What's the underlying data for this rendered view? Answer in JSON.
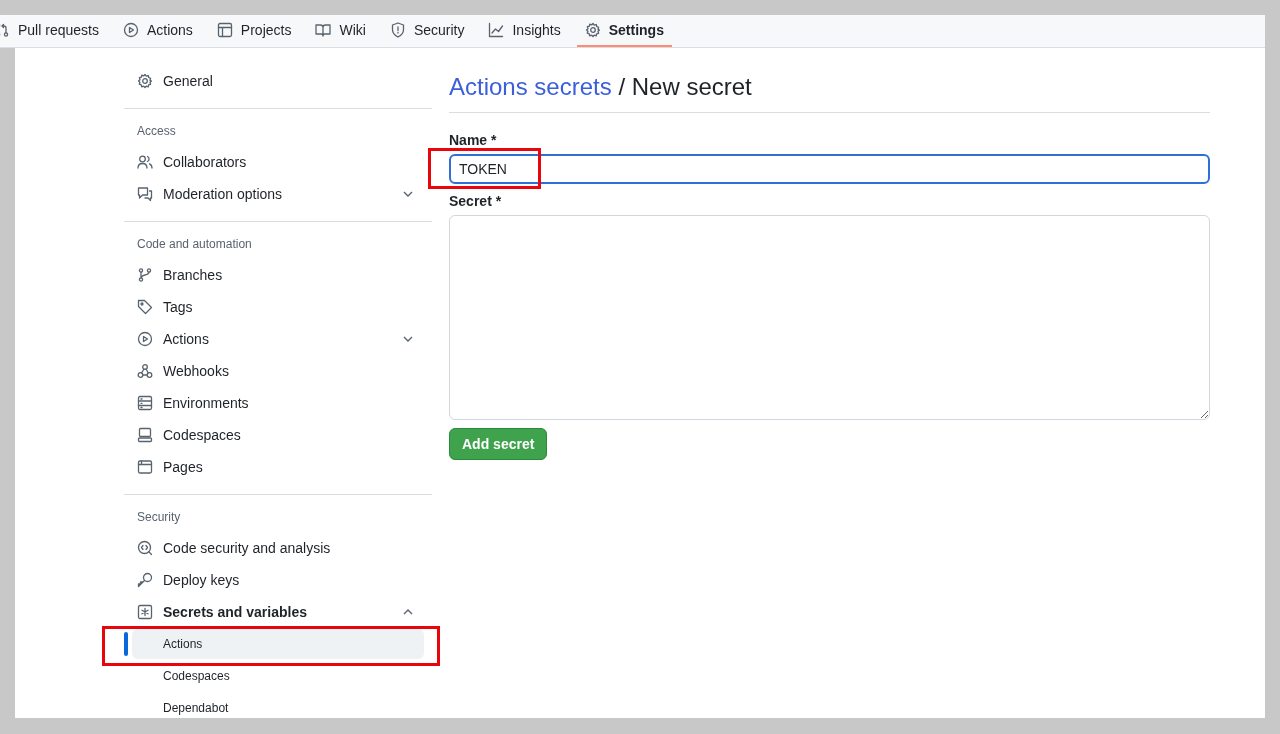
{
  "tabs": [
    {
      "label": "Pull requests",
      "selected": false
    },
    {
      "label": "Actions",
      "selected": false
    },
    {
      "label": "Projects",
      "selected": false
    },
    {
      "label": "Wiki",
      "selected": false
    },
    {
      "label": "Security",
      "selected": false
    },
    {
      "label": "Insights",
      "selected": false
    },
    {
      "label": "Settings",
      "selected": true
    }
  ],
  "sidebar": {
    "sections": [
      {
        "items": [
          {
            "label": "General"
          }
        ]
      },
      {
        "heading": "Access",
        "items": [
          {
            "label": "Collaborators"
          },
          {
            "label": "Moderation options",
            "expanded": false
          }
        ]
      },
      {
        "heading": "Code and automation",
        "items": [
          {
            "label": "Branches"
          },
          {
            "label": "Tags"
          },
          {
            "label": "Actions",
            "expanded": false
          },
          {
            "label": "Webhooks"
          },
          {
            "label": "Environments"
          },
          {
            "label": "Codespaces"
          },
          {
            "label": "Pages"
          }
        ]
      },
      {
        "heading": "Security",
        "items": [
          {
            "label": "Code security and analysis"
          },
          {
            "label": "Deploy keys"
          },
          {
            "label": "Secrets and variables",
            "expanded": true,
            "children": [
              {
                "label": "Actions",
                "selected": true,
                "highlighted": true
              },
              {
                "label": "Codespaces",
                "selected": false,
                "highlighted": false
              },
              {
                "label": "Dependabot",
                "selected": false,
                "highlighted": false
              }
            ]
          }
        ]
      }
    ]
  },
  "heading": {
    "link": "Actions secrets",
    "separator": "/",
    "title": "New secret"
  },
  "form": {
    "name": {
      "label": "Name *",
      "value": "TOKEN",
      "focused": true,
      "highlighted": true
    },
    "secret": {
      "label": "Secret *"
    },
    "submit": "Add secret"
  }
}
